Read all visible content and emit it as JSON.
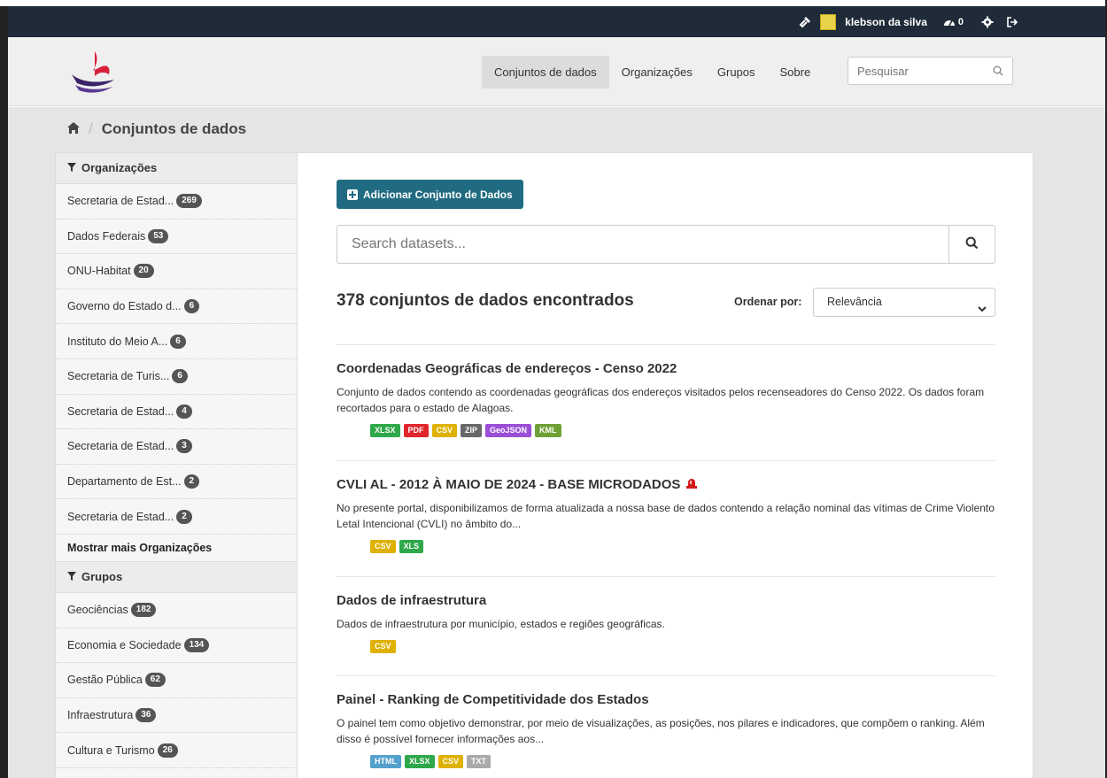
{
  "topbar": {
    "user_name": "klebson da silva",
    "dashboard_count": "0"
  },
  "nav": {
    "items": [
      "Conjuntos de dados",
      "Organizações",
      "Grupos",
      "Sobre"
    ],
    "search_placeholder": "Pesquisar"
  },
  "breadcrumb": {
    "current": "Conjuntos de dados"
  },
  "sidebar": {
    "org_heading": "Organizações",
    "orgs": [
      {
        "label": "Secretaria de Estad...",
        "count": "269"
      },
      {
        "label": "Dados Federais",
        "count": "53"
      },
      {
        "label": "ONU-Habitat",
        "count": "20"
      },
      {
        "label": "Governo do Estado d...",
        "count": "6"
      },
      {
        "label": "Instituto do Meio A...",
        "count": "6"
      },
      {
        "label": "Secretaria de Turis...",
        "count": "6"
      },
      {
        "label": "Secretaria de Estad...",
        "count": "4"
      },
      {
        "label": "Secretaria de Estad...",
        "count": "3"
      },
      {
        "label": "Departamento de Est...",
        "count": "2"
      },
      {
        "label": "Secretaria de Estad...",
        "count": "2"
      }
    ],
    "show_more": "Mostrar mais Organizações",
    "groups_heading": "Grupos",
    "groups": [
      {
        "label": "Geociências",
        "count": "182"
      },
      {
        "label": "Economia e Sociedade",
        "count": "134"
      },
      {
        "label": "Gestão Pública",
        "count": "62"
      },
      {
        "label": "Infraestrutura",
        "count": "36"
      },
      {
        "label": "Cultura e Turismo",
        "count": "26"
      }
    ]
  },
  "main": {
    "add_button": "Adicionar Conjunto de Dados",
    "search_placeholder": "Search datasets...",
    "count_heading": "378 conjuntos de dados encontrados",
    "sort_label": "Ordenar por:",
    "sort_value": "Relevância",
    "datasets": [
      {
        "title": "Coordenadas Geográficas de endereços - Censo 2022",
        "description": "Conjunto de dados contendo as coordenadas geográficas dos endereços visitados pelos recenseadores do Censo 2022. Os dados foram recortados para o estado de Alagoas.",
        "formats": [
          {
            "label": "XLSX",
            "color": "#2ea84a"
          },
          {
            "label": "PDF",
            "color": "#e0262b"
          },
          {
            "label": "CSV",
            "color": "#dfb100"
          },
          {
            "label": "ZIP",
            "color": "#686868"
          },
          {
            "label": "GeoJSON",
            "color": "#9b4fd6"
          },
          {
            "label": "KML",
            "color": "#6ea135"
          }
        ]
      },
      {
        "title": "CVLI AL - 2012 À MAIO DE 2024 - BASE MICRODADOS",
        "description": "No presente portal, disponibilizamos de forma atualizada a nossa base de dados contendo a relação nominal das vítimas de Crime Violento Letal Intencional (CVLI) no âmbito do...",
        "formats": [
          {
            "label": "CSV",
            "color": "#dfb100"
          },
          {
            "label": "XLS",
            "color": "#2ea84a"
          }
        ]
      },
      {
        "title": "Dados de infraestrutura",
        "description": "Dados de infraestrutura por município, estados e regiões geográficas.",
        "formats": [
          {
            "label": "CSV",
            "color": "#dfb100"
          }
        ]
      },
      {
        "title": "Painel - Ranking de Competitividade dos Estados",
        "description": "O painel tem como objetivo demonstrar, por meio de visualizações, as posições, nos pilares e indicadores, que compõem o ranking. Além disso é possível fornecer informações aos...",
        "formats": [
          {
            "label": "HTML",
            "color": "#55a1ce"
          },
          {
            "label": "XLSX",
            "color": "#2ea84a"
          },
          {
            "label": "CSV",
            "color": "#dfb100"
          },
          {
            "label": "TXT",
            "color": "#aaaaaa"
          }
        ]
      }
    ]
  }
}
